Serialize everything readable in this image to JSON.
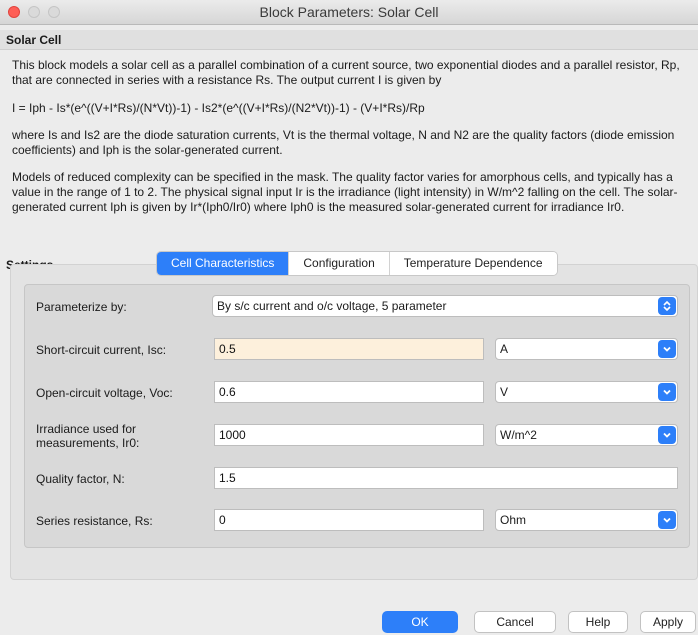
{
  "window": {
    "title": "Block Parameters: Solar Cell"
  },
  "block": {
    "name": "Solar Cell"
  },
  "description": {
    "p1": "This block models a solar cell as a parallel combination of a current source, two exponential diodes and a parallel resistor, Rp, that are connected in series with a resistance Rs. The output current I is given by",
    "equation": "I = Iph - Is*(e^((V+I*Rs)/(N*Vt))-1) - Is2*(e^((V+I*Rs)/(N2*Vt))-1) - (V+I*Rs)/Rp",
    "p2": "where Is and Is2 are the diode saturation currents, Vt is the thermal voltage, N and N2 are the quality factors (diode emission coefficients) and Iph is the solar-generated current.",
    "p3": "Models of reduced complexity can be specified in the mask. The quality factor varies for amorphous cells, and typically has a value in the range of 1 to 2. The physical signal input Ir is the irradiance (light intensity) in W/m^2 falling on the cell. The solar-generated current Iph is given by Ir*(Iph0/Ir0) where Iph0 is the measured solar-generated current for irradiance Ir0."
  },
  "settings": {
    "label": "Settings",
    "tabs": [
      "Cell Characteristics",
      "Configuration",
      "Temperature Dependence"
    ],
    "active_tab": "Cell Characteristics"
  },
  "params": {
    "parameterize": {
      "label": "Parameterize by:",
      "value": "By s/c current and o/c voltage, 5 parameter"
    },
    "isc": {
      "label": "Short-circuit current, Isc:",
      "value": "0.5",
      "unit": "A"
    },
    "voc": {
      "label": "Open-circuit voltage, Voc:",
      "value": "0.6",
      "unit": "V"
    },
    "ir0": {
      "label_line1": "Irradiance used for",
      "label_line2": "measurements, Ir0:",
      "value": "1000",
      "unit": "W/m^2"
    },
    "n": {
      "label": "Quality factor, N:",
      "value": "1.5"
    },
    "rs": {
      "label": "Series resistance, Rs:",
      "value": "0",
      "unit": "Ohm"
    }
  },
  "buttons": {
    "ok": "OK",
    "cancel": "Cancel",
    "help": "Help",
    "apply": "Apply"
  },
  "colors": {
    "accent": "#2d7ff9",
    "highlight_field": "#fdf0dc",
    "close": "#fe5f57"
  },
  "icons": {
    "dropdown": "chevron-down-icon",
    "popup": "up-down-arrows-icon"
  }
}
